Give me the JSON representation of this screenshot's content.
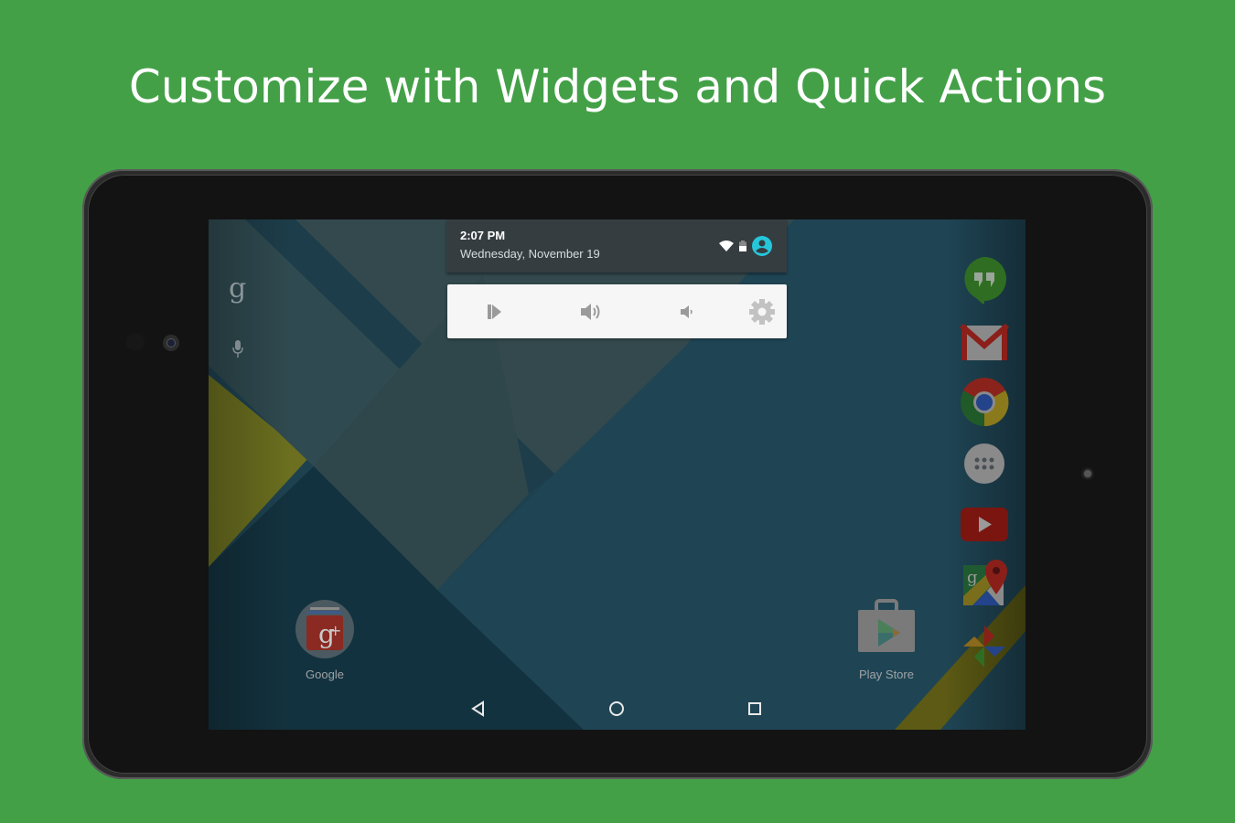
{
  "headline": "Customize with Widgets and Quick Actions",
  "device": {
    "type": "tablet",
    "screen": {
      "quick_settings": {
        "time": "2:07 PM",
        "date": "Wednesday, November 19",
        "status_icons": [
          "wifi-icon",
          "battery-icon",
          "user-account-icon"
        ],
        "accent_color": "#26c6da",
        "actions": [
          {
            "name": "next-track",
            "icon": "skip-next-icon"
          },
          {
            "name": "volume-up",
            "icon": "volume-up-icon"
          },
          {
            "name": "volume-down",
            "icon": "volume-down-icon"
          },
          {
            "name": "settings",
            "icon": "gear-icon"
          }
        ]
      },
      "search_bar": {
        "google_glyph": "g",
        "voice_icon": "mic-icon"
      },
      "home_apps": [
        {
          "label": "Google",
          "icon": "google-plus-icon"
        },
        {
          "label": "Play Store",
          "icon": "play-store-icon"
        }
      ],
      "dock": [
        "hangouts-icon",
        "gmail-icon",
        "chrome-icon",
        "app-drawer-icon",
        "youtube-icon",
        "maps-icon",
        "photos-icon"
      ],
      "navigation": [
        "back-button",
        "home-button",
        "recents-button"
      ]
    }
  },
  "colors": {
    "background": "#43a047",
    "panel_dark": "#353d41",
    "panel_light": "#f6f6f6"
  }
}
